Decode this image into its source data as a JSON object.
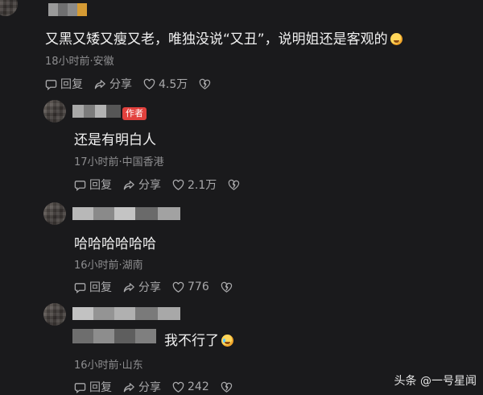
{
  "top_comment": {
    "text": "又黑又矮又瘦又老，唯独没说“又丑”，说明姐还是客观的",
    "emoji": "grinning-sweat-emoji",
    "meta": "18小时前·安徽",
    "reply_label": "回复",
    "share_label": "分享",
    "like_count": "4.5万"
  },
  "replies": [
    {
      "badge": "作者",
      "text": "还是有明白人",
      "meta": "17小时前·中国香港",
      "reply_label": "回复",
      "share_label": "分享",
      "like_count": "2.1万"
    },
    {
      "text": "哈哈哈哈哈哈",
      "meta": "16小时前·湖南",
      "reply_label": "回复",
      "share_label": "分享",
      "like_count": "776"
    },
    {
      "text": "我不行了",
      "emoji": "laugh-cry-emoji",
      "meta": "16小时前·山东",
      "reply_label": "回复",
      "share_label": "分享",
      "like_count": "242"
    }
  ],
  "watermark": "头条 @一号星闻",
  "colors": {
    "background": "#1a1a1c",
    "text": "#f0f0f0",
    "meta": "#8e8e90",
    "badge": "#e2413d"
  }
}
